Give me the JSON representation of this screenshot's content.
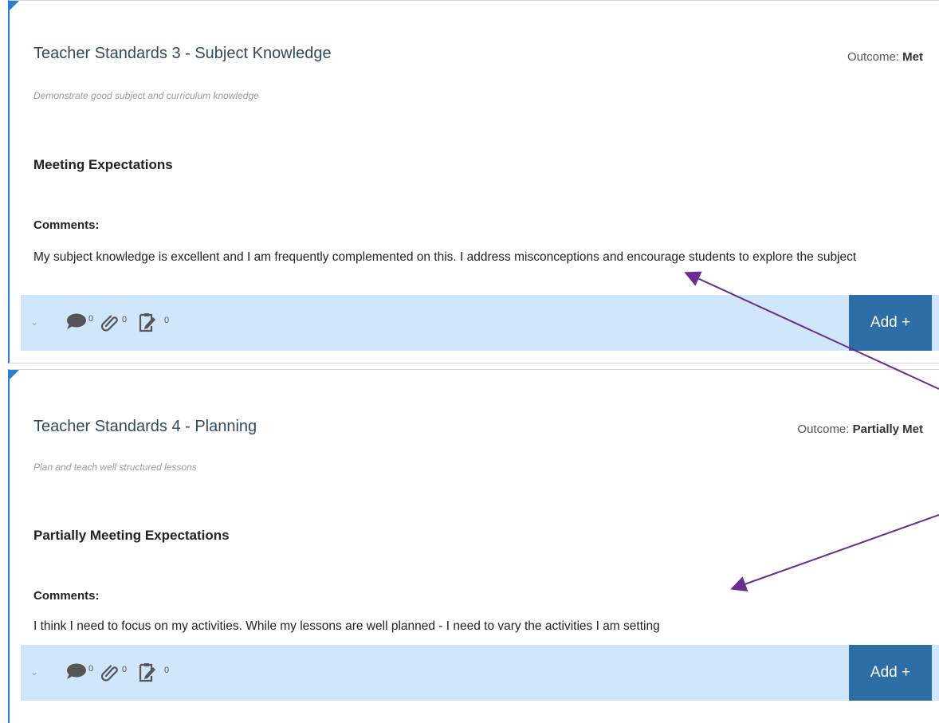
{
  "cards": [
    {
      "title": "Teacher Standards 3 - Subject Knowledge",
      "outcome_label": "Outcome:",
      "outcome_value": "Met",
      "description": "Demonstrate good subject and curriculum knowledge",
      "level": "Meeting Expectations",
      "comments_label": "Comments:",
      "comment": "My subject knowledge is excellent and I am frequently complemented on this. I address misconceptions and encourage students to explore the subject",
      "counts": {
        "comments": "0",
        "attachments": "0",
        "evidence": "0"
      },
      "add_label": "Add +"
    },
    {
      "title": "Teacher Standards 4 - Planning",
      "outcome_label": "Outcome:",
      "outcome_value": "Partially Met",
      "description": "Plan and teach well structured lessons",
      "level": "Partially Meeting Expectations",
      "comments_label": "Comments:",
      "comment": "I think I need to focus on my activities. While my lessons are well planned - I need to vary the activities I am setting",
      "counts": {
        "comments": "0",
        "attachments": "0",
        "evidence": "0"
      },
      "add_label": "Add +"
    }
  ],
  "colors": {
    "accent": "#2a7fd4",
    "bar": "#cfe6fb",
    "button": "#2e6ea6",
    "annotation_arrow": "#6a2c91"
  }
}
